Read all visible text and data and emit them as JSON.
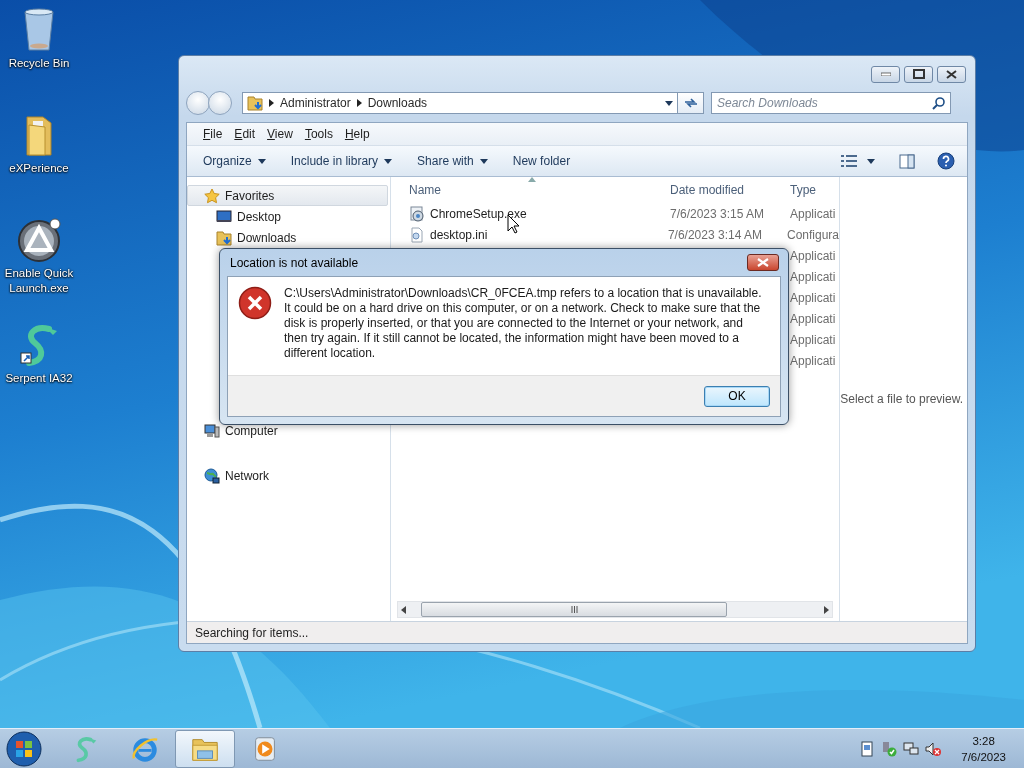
{
  "desktop_icons": [
    {
      "label": "Recycle Bin",
      "kind": "recycle"
    },
    {
      "label": "eXPerience",
      "kind": "folder"
    },
    {
      "label": "Enable Quick Launch.exe",
      "kind": "autoit"
    },
    {
      "label": "Serpent IA32",
      "kind": "serpent"
    }
  ],
  "explorer": {
    "address": {
      "crumbs": [
        "Administrator",
        "Downloads"
      ]
    },
    "search": {
      "placeholder": "Search Downloads"
    },
    "menu": [
      "File",
      "Edit",
      "View",
      "Tools",
      "Help"
    ],
    "commands": [
      {
        "label": "Organize",
        "dropdown": true
      },
      {
        "label": "Include in library",
        "dropdown": true
      },
      {
        "label": "Share with",
        "dropdown": true
      },
      {
        "label": "New folder",
        "dropdown": false
      }
    ],
    "nav": [
      {
        "label": "Favorites",
        "kind": "star",
        "highlighted": true
      },
      {
        "label": "Desktop",
        "kind": "desktop",
        "highlighted": false
      },
      {
        "label": "Downloads",
        "kind": "downloads",
        "highlighted": false
      },
      {
        "label": "Computer",
        "kind": "computer",
        "highlighted": false
      },
      {
        "label": "Network",
        "kind": "network",
        "highlighted": false
      }
    ],
    "columns": [
      "Name",
      "Date modified",
      "Type"
    ],
    "rows": [
      {
        "kind": "exe",
        "name": "ChromeSetup.exe",
        "date": "7/6/2023 3:15 AM",
        "type": "Applicati"
      },
      {
        "kind": "ini",
        "name": "desktop.ini",
        "date": "7/6/2023 3:14 AM",
        "type": "Configura"
      },
      {
        "kind": "hidden",
        "type": "Applicati"
      },
      {
        "kind": "hidden",
        "type": "Applicati"
      },
      {
        "kind": "hidden",
        "type": "Applicati"
      },
      {
        "kind": "hidden",
        "type": "Applicati"
      },
      {
        "kind": "hidden",
        "type": "Applicati"
      },
      {
        "kind": "hidden",
        "type": "Applicati"
      }
    ],
    "preview": "Select a file to preview.",
    "status": "Searching for items..."
  },
  "dialog": {
    "title": "Location is not available",
    "message": "C:\\Users\\Administrator\\Downloads\\CR_0FCEA.tmp refers to a location that is unavailable. It could be on a hard drive on this computer, or on a network. Check to make sure that the disk is properly inserted, or that you are connected to the Internet or your network, and then try again. If it still cannot be located, the information might have been moved to a different location.",
    "button": "OK"
  },
  "taskbar": {
    "pinned": [
      {
        "kind": "serpent",
        "active": false
      },
      {
        "kind": "ie",
        "active": false
      },
      {
        "kind": "explorer",
        "active": true
      },
      {
        "kind": "media",
        "active": false
      }
    ],
    "time": "3:28",
    "date": "7/6/2023"
  }
}
